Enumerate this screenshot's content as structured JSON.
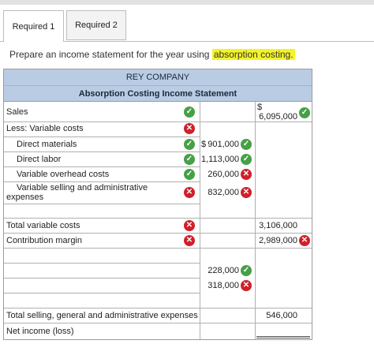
{
  "tabs": [
    {
      "label": "Required 1",
      "active": true
    },
    {
      "label": "Required 2",
      "active": false
    }
  ],
  "instruction": {
    "prefix": "Prepare an income statement for the year using ",
    "highlight": "absorption costing."
  },
  "statement": {
    "company": "REY COMPANY",
    "title": "Absorption Costing Income Statement",
    "rows": {
      "sales": {
        "label": "Sales",
        "status": "correct",
        "dollar": "$",
        "total": "6,095,000",
        "total_status": "correct"
      },
      "less_var": {
        "label": "Less:  Variable costs",
        "status": "incorrect"
      },
      "dm": {
        "label": "Direct materials",
        "status": "correct",
        "dollar": "$",
        "amount": "901,000",
        "amount_status": "correct"
      },
      "dl": {
        "label": "Direct labor",
        "status": "correct",
        "amount": "1,113,000",
        "amount_status": "correct"
      },
      "voh": {
        "label": "Variable overhead costs",
        "status": "correct",
        "amount": "260,000",
        "amount_status": "incorrect"
      },
      "vsa": {
        "label_line1": "Variable selling and administrative",
        "label_line2": "expenses",
        "status": "incorrect",
        "amount": "832,000",
        "amount_status": "incorrect"
      },
      "tvc": {
        "label": "Total variable costs",
        "status": "incorrect",
        "total": "3,106,000"
      },
      "cm": {
        "label": "Contribution margin",
        "status": "incorrect",
        "total": "2,989,000",
        "total_status": "incorrect"
      },
      "fixed1": {
        "amount": "228,000",
        "amount_status": "correct"
      },
      "fixed2": {
        "amount": "318,000",
        "amount_status": "incorrect"
      },
      "tsga": {
        "label": "Total selling, general and administrative expenses",
        "total": "546,000"
      },
      "ni": {
        "label": "Net income (loss)"
      }
    }
  },
  "colors": {
    "header_bg": "#b9cce4",
    "highlight": "#f3f32a",
    "correct": "#46a046",
    "incorrect": "#d0202a"
  }
}
